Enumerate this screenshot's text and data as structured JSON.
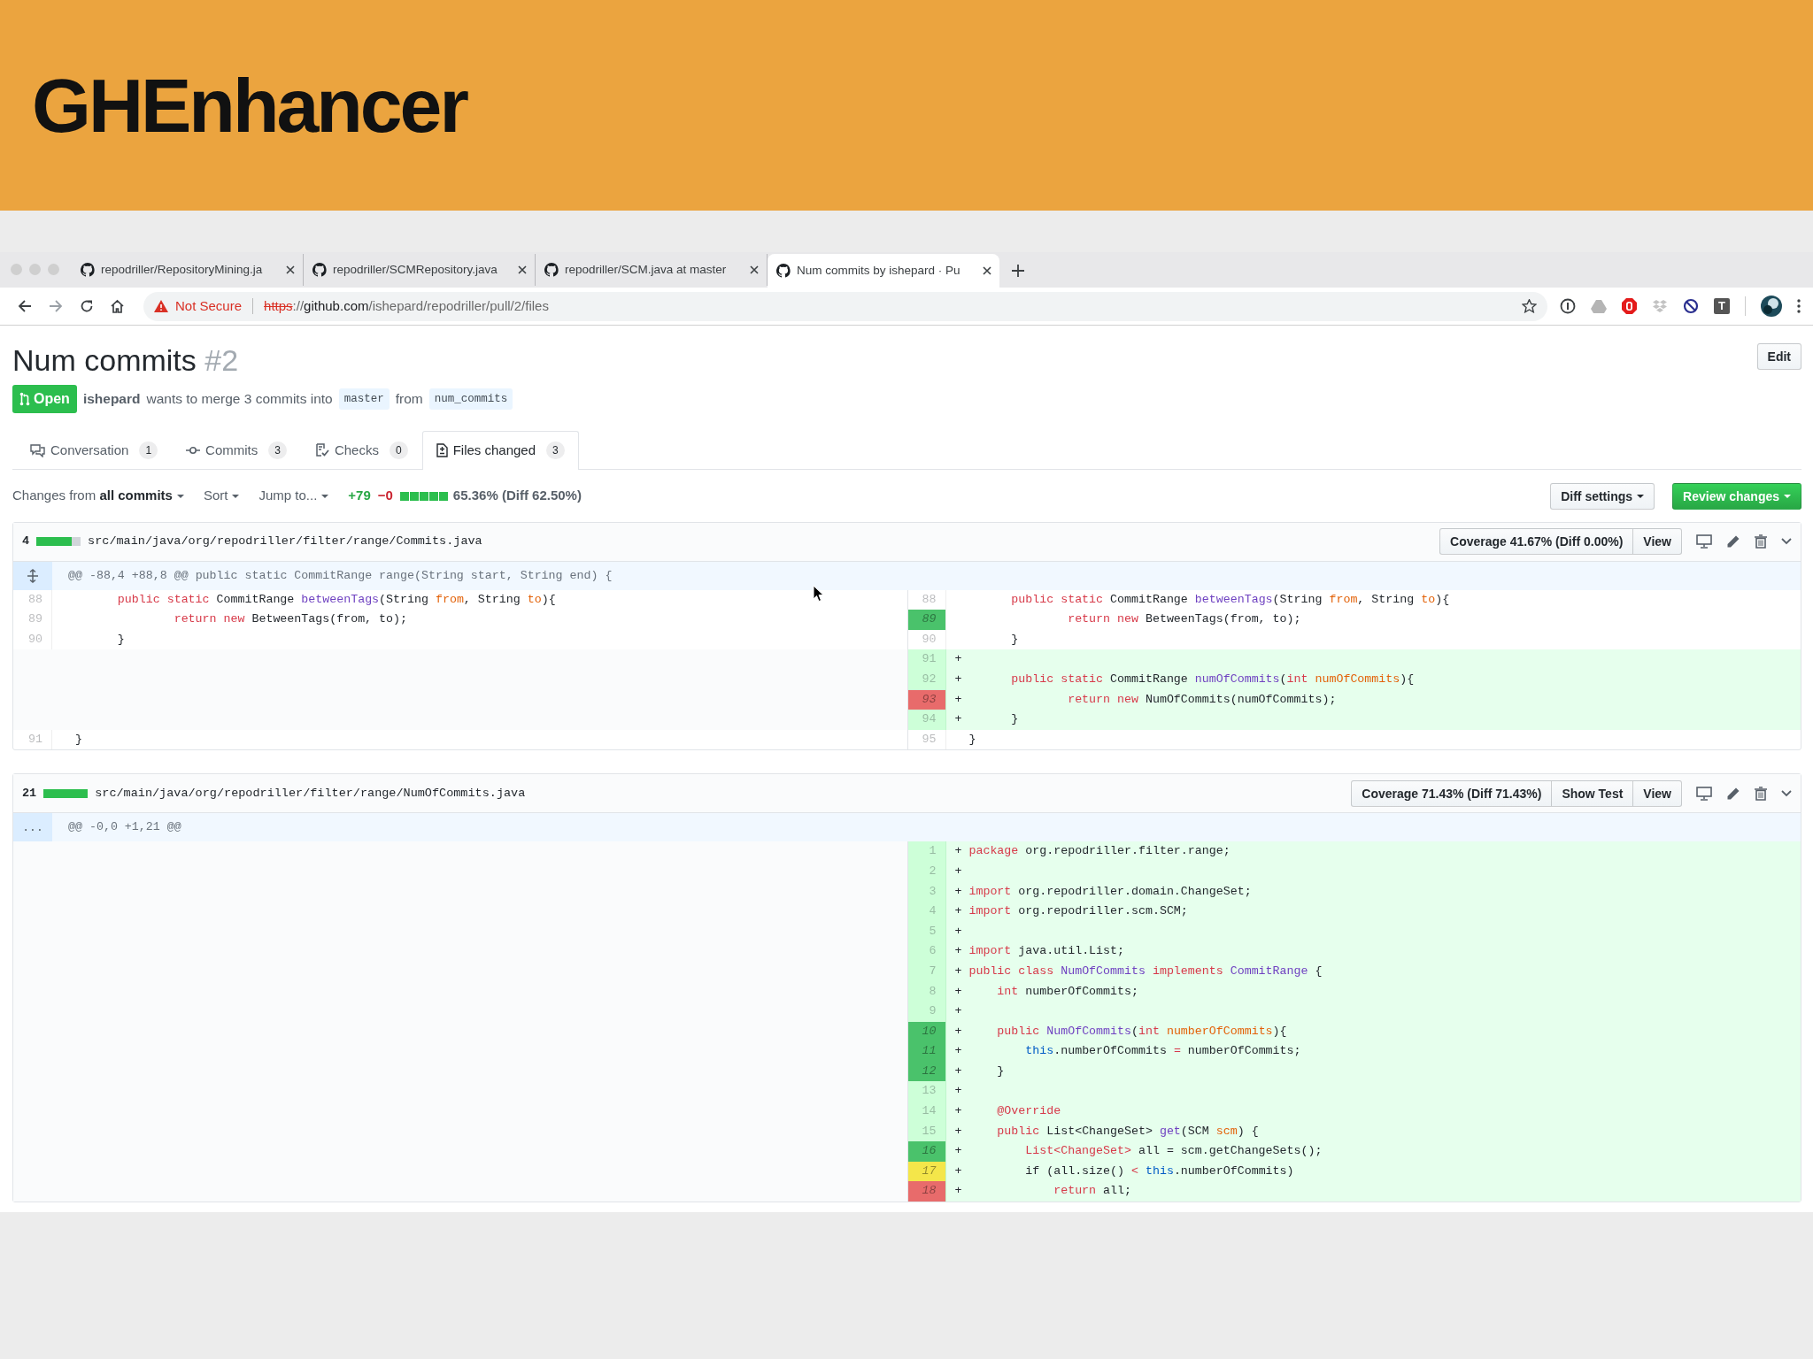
{
  "slide": {
    "title": "GHEnhancer"
  },
  "browser": {
    "tabs": [
      {
        "title": "repodriller/RepositoryMining.ja",
        "selected": false
      },
      {
        "title": "repodriller/SCMRepository.java",
        "selected": false
      },
      {
        "title": "repodriller/SCM.java at master",
        "selected": false
      },
      {
        "title": "Num commits by ishepard · Pu",
        "selected": true
      }
    ],
    "security": "Not Secure",
    "url": {
      "scheme": "https",
      "separator": "://",
      "host": "github.com",
      "path": "/ishepard/repodriller/pull/2/files"
    },
    "extension_label": "T"
  },
  "pr": {
    "title": "Num commits",
    "number": "#2",
    "edit": "Edit",
    "state": "Open",
    "author": "ishepard",
    "summary": "wants to merge 3 commits into",
    "base": "master",
    "from": "from",
    "head": "num_commits"
  },
  "tabs": [
    {
      "label": "Conversation",
      "count": "1",
      "selected": false
    },
    {
      "label": "Commits",
      "count": "3",
      "selected": false
    },
    {
      "label": "Checks",
      "count": "0",
      "selected": false
    },
    {
      "label": "Files changed",
      "count": "3",
      "selected": true
    }
  ],
  "toolbar": {
    "changes": "Changes from **all commits**",
    "sort": "Sort",
    "jump": "Jump to...",
    "additions": "+79",
    "deletions": "−0",
    "diffstat": [
      {
        "color": "#2cbe4e"
      },
      {
        "color": "#2cbe4e"
      },
      {
        "color": "#2cbe4e"
      },
      {
        "color": "#2cbe4e"
      },
      {
        "color": "#2cbe4e"
      }
    ],
    "coverage": "65.36% (Diff 62.50%)",
    "diff_settings": "Diff settings",
    "review": "Review changes"
  },
  "files": [
    {
      "changes": "4",
      "diffstat": [
        {
          "color": "#2cbe4e"
        },
        {
          "color": "#2cbe4e"
        },
        {
          "color": "#2cbe4e"
        },
        {
          "color": "#2cbe4e"
        },
        {
          "color": "#d1d5da"
        }
      ],
      "path": "src/main/java/org/repodriller/filter/range/Commits.java",
      "buttons": [
        "Coverage 41.67% (Diff 0.00%)",
        "View"
      ],
      "hunk": "@@ -88,4 +88,8 @@ public static CommitRange range(String start, String end) {",
      "rows": [
        {
          "left": {
            "num": "88",
            "code": [
              {
                "kind": "keyword",
                "text": "      public static "
              },
              {
                "kind": "plain",
                "text": "CommitRange "
              },
              {
                "kind": "function",
                "text": "betweenTags"
              },
              {
                "kind": "plain",
                "text": "(String "
              },
              {
                "kind": "param",
                "text": "from"
              },
              {
                "kind": "plain",
                "text": ", String "
              },
              {
                "kind": "param",
                "text": "to"
              },
              {
                "kind": "plain",
                "text": "){"
              }
            ]
          },
          "right": {
            "num": "88",
            "kind": "context",
            "code": [
              {
                "kind": "keyword",
                "text": "      public static "
              },
              {
                "kind": "plain",
                "text": "CommitRange "
              },
              {
                "kind": "function",
                "text": "betweenTags"
              },
              {
                "kind": "plain",
                "text": "(String "
              },
              {
                "kind": "param",
                "text": "from"
              },
              {
                "kind": "plain",
                "text": ", String "
              },
              {
                "kind": "param",
                "text": "to"
              },
              {
                "kind": "plain",
                "text": "){"
              }
            ]
          }
        },
        {
          "left": {
            "num": "89",
            "code": [
              {
                "kind": "keyword",
                "text": "              return new "
              },
              {
                "kind": "plain",
                "text": "BetweenTags(from, to);"
              }
            ]
          },
          "right": {
            "num": "89",
            "kind": "context",
            "color": "#4ac26b",
            "code": [
              {
                "kind": "keyword",
                "text": "              return new "
              },
              {
                "kind": "plain",
                "text": "BetweenTags(from, to);"
              }
            ]
          }
        },
        {
          "left": {
            "num": "90",
            "code": [
              {
                "kind": "plain",
                "text": "      }"
              }
            ]
          },
          "right": {
            "num": "90",
            "kind": "context",
            "code": [
              {
                "kind": "plain",
                "text": "      }"
              }
            ]
          }
        },
        {
          "right": {
            "num": "91",
            "kind": "added",
            "sign": "+"
          }
        },
        {
          "right": {
            "num": "92",
            "kind": "added",
            "sign": "+",
            "code": [
              {
                "kind": "keyword",
                "text": "      public static "
              },
              {
                "kind": "plain",
                "text": "CommitRange "
              },
              {
                "kind": "function",
                "text": "numOfCommits"
              },
              {
                "kind": "plain",
                "text": "("
              },
              {
                "kind": "keyword",
                "text": "int "
              },
              {
                "kind": "param",
                "text": "numOfCommits"
              },
              {
                "kind": "plain",
                "text": "){"
              }
            ]
          }
        },
        {
          "right": {
            "num": "93",
            "kind": "added",
            "sign": "+",
            "color": "#e86b6b",
            "code": [
              {
                "kind": "keyword",
                "text": "              return new "
              },
              {
                "kind": "plain",
                "text": "NumOfCommits(numOfCommits);"
              }
            ]
          }
        },
        {
          "right": {
            "num": "94",
            "kind": "added",
            "sign": "+",
            "code": [
              {
                "kind": "plain",
                "text": "      }"
              }
            ]
          }
        },
        {
          "left": {
            "num": "91",
            "code": [
              {
                "kind": "plain",
                "text": "}"
              }
            ]
          },
          "right": {
            "num": "95",
            "kind": "context",
            "code": [
              {
                "kind": "plain",
                "text": "}"
              }
            ]
          }
        }
      ]
    },
    {
      "changes": "21",
      "diffstat": [
        {
          "color": "#2cbe4e"
        },
        {
          "color": "#2cbe4e"
        },
        {
          "color": "#2cbe4e"
        },
        {
          "color": "#2cbe4e"
        },
        {
          "color": "#2cbe4e"
        }
      ],
      "path": "src/main/java/org/repodriller/filter/range/NumOfCommits.java",
      "buttons": [
        "Coverage 71.43% (Diff 71.43%)",
        "Show Test",
        "View"
      ],
      "expander_text": "...",
      "hunk": "@@ -0,0 +1,21 @@",
      "rows": [
        {
          "right": {
            "num": "1",
            "kind": "added",
            "sign": "+",
            "code": [
              {
                "kind": "keyword",
                "text": "package "
              },
              {
                "kind": "plain",
                "text": "org.repodriller.filter.range;"
              }
            ]
          }
        },
        {
          "right": {
            "num": "2",
            "kind": "added",
            "sign": "+"
          }
        },
        {
          "right": {
            "num": "3",
            "kind": "added",
            "sign": "+",
            "code": [
              {
                "kind": "keyword",
                "text": "import "
              },
              {
                "kind": "plain",
                "text": "org.repodriller.domain.ChangeSet;"
              }
            ]
          }
        },
        {
          "right": {
            "num": "4",
            "kind": "added",
            "sign": "+",
            "code": [
              {
                "kind": "keyword",
                "text": "import "
              },
              {
                "kind": "plain",
                "text": "org.repodriller.scm.SCM;"
              }
            ]
          }
        },
        {
          "right": {
            "num": "5",
            "kind": "added",
            "sign": "+"
          }
        },
        {
          "right": {
            "num": "6",
            "kind": "added",
            "sign": "+",
            "code": [
              {
                "kind": "keyword",
                "text": "import "
              },
              {
                "kind": "plain",
                "text": "java.util.List;"
              }
            ]
          }
        },
        {
          "right": {
            "num": "7",
            "kind": "added",
            "sign": "+",
            "code": [
              {
                "kind": "keyword",
                "text": "public class "
              },
              {
                "kind": "function",
                "text": "NumOfCommits "
              },
              {
                "kind": "keyword",
                "text": "implements "
              },
              {
                "kind": "function",
                "text": "CommitRange "
              },
              {
                "kind": "plain",
                "text": "{"
              }
            ]
          }
        },
        {
          "right": {
            "num": "8",
            "kind": "added",
            "sign": "+",
            "code": [
              {
                "kind": "keyword",
                "text": "    int "
              },
              {
                "kind": "plain",
                "text": "numberOfCommits;"
              }
            ]
          }
        },
        {
          "right": {
            "num": "9",
            "kind": "added",
            "sign": "+"
          }
        },
        {
          "right": {
            "num": "10",
            "kind": "added",
            "sign": "+",
            "color": "#4ac26b",
            "code": [
              {
                "kind": "keyword",
                "text": "    public "
              },
              {
                "kind": "function",
                "text": "NumOfCommits"
              },
              {
                "kind": "plain",
                "text": "("
              },
              {
                "kind": "keyword",
                "text": "int "
              },
              {
                "kind": "param",
                "text": "numberOfCommits"
              },
              {
                "kind": "plain",
                "text": "){"
              }
            ]
          }
        },
        {
          "right": {
            "num": "11",
            "kind": "added",
            "sign": "+",
            "color": "#4ac26b",
            "code": [
              {
                "kind": "constant",
                "text": "        this"
              },
              {
                "kind": "plain",
                "text": ".numberOfCommits "
              },
              {
                "kind": "keyword",
                "text": "="
              },
              {
                "kind": "plain",
                "text": " numberOfCommits;"
              }
            ]
          }
        },
        {
          "right": {
            "num": "12",
            "kind": "added",
            "sign": "+",
            "color": "#4ac26b",
            "code": [
              {
                "kind": "plain",
                "text": "    }"
              }
            ]
          }
        },
        {
          "right": {
            "num": "13",
            "kind": "added",
            "sign": "+"
          }
        },
        {
          "right": {
            "num": "14",
            "kind": "added",
            "sign": "+",
            "code": [
              {
                "kind": "keyword",
                "text": "    @Override"
              }
            ]
          }
        },
        {
          "right": {
            "num": "15",
            "kind": "added",
            "sign": "+",
            "code": [
              {
                "kind": "keyword",
                "text": "    public "
              },
              {
                "kind": "plain",
                "text": "List<ChangeSet> "
              },
              {
                "kind": "function",
                "text": "get"
              },
              {
                "kind": "plain",
                "text": "(SCM "
              },
              {
                "kind": "param",
                "text": "scm"
              },
              {
                "kind": "plain",
                "text": ") {"
              }
            ]
          }
        },
        {
          "right": {
            "num": "16",
            "kind": "added",
            "sign": "+",
            "color": "#4ac26b",
            "code": [
              {
                "kind": "keyword",
                "text": "        List<ChangeSet>"
              },
              {
                "kind": "plain",
                "text": " all = scm.getChangeSets();"
              }
            ]
          }
        },
        {
          "right": {
            "num": "17",
            "kind": "added",
            "sign": "+",
            "color": "#f4e64a",
            "code": [
              {
                "kind": "plain",
                "text": "        if (all.size() "
              },
              {
                "kind": "keyword",
                "text": "<"
              },
              {
                "kind": "constant",
                "text": " this"
              },
              {
                "kind": "plain",
                "text": ".numberOfCommits)"
              }
            ]
          }
        },
        {
          "right": {
            "num": "18",
            "kind": "added",
            "sign": "+",
            "color": "#e86b6b",
            "code": [
              {
                "kind": "keyword",
                "text": "            return "
              },
              {
                "kind": "plain",
                "text": "all;"
              }
            ]
          }
        }
      ]
    }
  ]
}
